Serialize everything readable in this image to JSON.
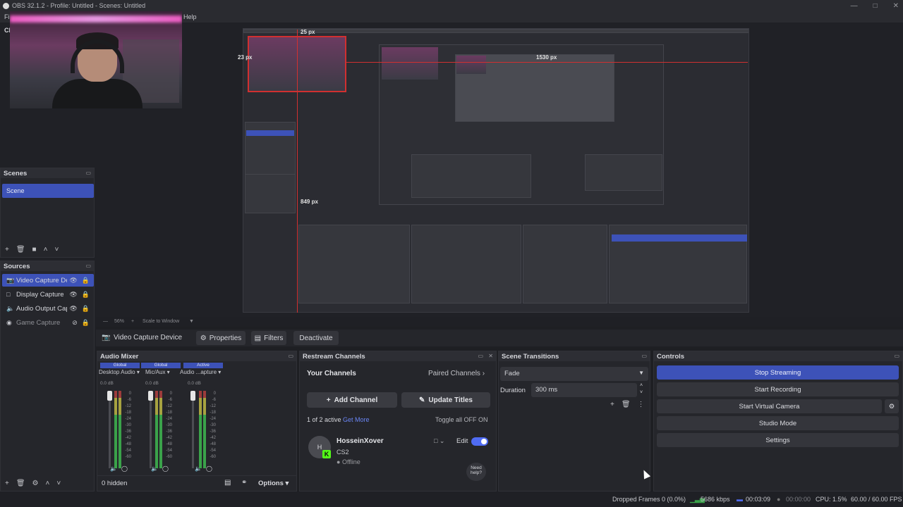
{
  "window": {
    "title": "OBS 32.1.2 - Profile: Untitled - Scenes: Untitled"
  },
  "menu": {
    "file": "Fi",
    "help": "Help",
    "left_clip": "Ch"
  },
  "preview": {
    "labels": {
      "top": "25 px",
      "left": "23 px",
      "right": "1530 px",
      "bottom": "849 px"
    },
    "zoom": "56%",
    "scale_mode": "Scale to Window"
  },
  "scenes": {
    "title": "Scenes",
    "items": [
      "Scene"
    ]
  },
  "sources": {
    "title": "Sources",
    "items": [
      {
        "name": "Video Capture Dev",
        "icon": "camera-icon",
        "selected": true,
        "hidden": false
      },
      {
        "name": "Display Capture",
        "icon": "monitor-icon",
        "selected": false,
        "hidden": false
      },
      {
        "name": "Audio Output Cap",
        "icon": "speaker-icon",
        "selected": false,
        "hidden": false
      },
      {
        "name": "Game Capture",
        "icon": "gamepad-icon",
        "selected": false,
        "hidden": true
      }
    ]
  },
  "propbar": {
    "source_name": "Video Capture Device",
    "properties": "Properties",
    "filters": "Filters",
    "deactivate": "Deactivate"
  },
  "mixer": {
    "title": "Audio Mixer",
    "channels": [
      {
        "tag": "Global",
        "name": "Desktop Audio",
        "db": "0.0 dB"
      },
      {
        "tag": "Global",
        "name": "Mic/Aux",
        "db": "0.0 dB"
      },
      {
        "tag": "Active",
        "name": "Audio ...apture",
        "db": "0.0 dB"
      }
    ],
    "scale": [
      "0",
      "-6",
      "-12",
      "-18",
      "-24",
      "-30",
      "-36",
      "-42",
      "-48",
      "-54",
      "-60"
    ],
    "hidden": "0 hidden",
    "options": "Options"
  },
  "restream": {
    "title": "Restream Channels",
    "your_channels": "Your Channels",
    "paired_channels": "Paired Channels",
    "add_channel": "Add Channel",
    "update_titles": "Update Titles",
    "active_count": "1 of 2 active",
    "get_more": "Get More",
    "toggle_all": "Toggle all OFF",
    "toggle_on": "ON",
    "channel": {
      "avatar": "H",
      "name": "HosseinXover",
      "game": "CS2",
      "status": "Offline",
      "edit": "Edit"
    },
    "help": "Need help?"
  },
  "transitions": {
    "title": "Scene Transitions",
    "selected": "Fade",
    "duration_label": "Duration",
    "duration_value": "300 ms"
  },
  "controls": {
    "title": "Controls",
    "buttons": [
      "Stop Streaming",
      "Start Recording",
      "Start Virtual Camera",
      "Studio Mode",
      "Settings"
    ]
  },
  "status": {
    "dropped": "Dropped Frames 0 (0.0%)",
    "bitrate": "5686 kbps",
    "stream_time": "00:03:09",
    "rec_time": "00:00:00",
    "cpu": "CPU: 1.5%",
    "fps": "60.00 / 60.00 FPS"
  },
  "colors": {
    "accent": "#3d52b8",
    "toggle": "#4f6bf2",
    "kick": "#53fc18"
  }
}
